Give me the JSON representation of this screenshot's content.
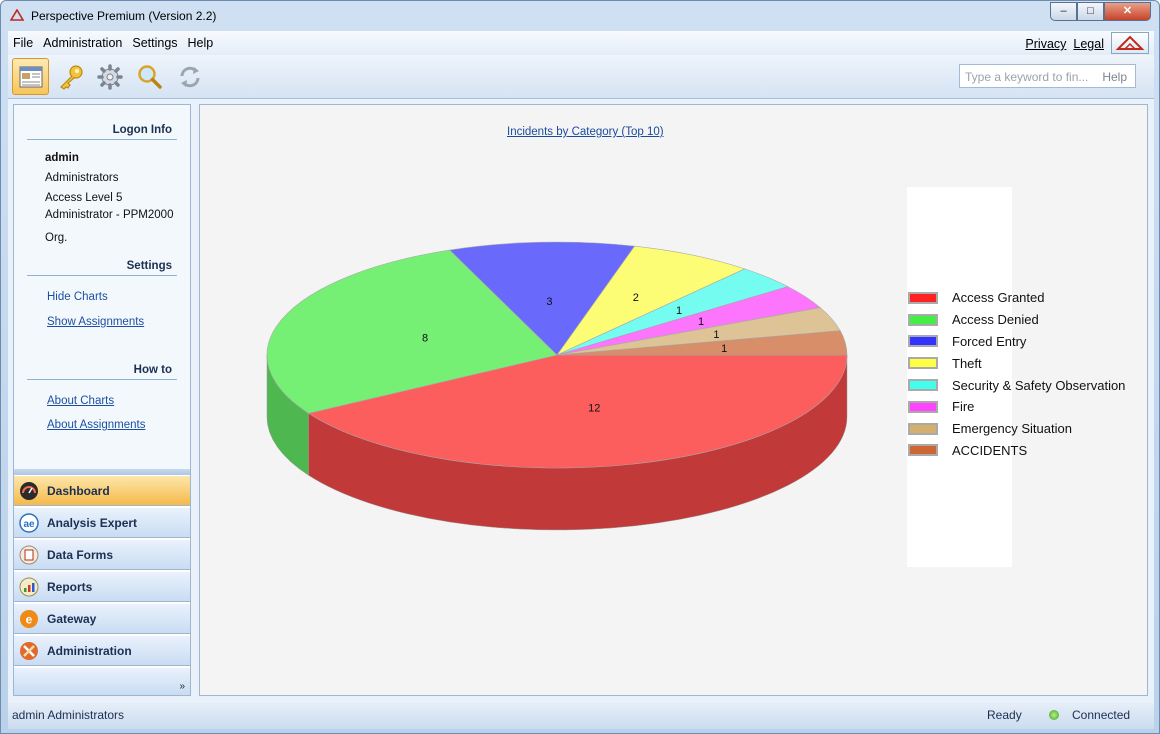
{
  "window": {
    "title": "Perspective Premium (Version 2.2)",
    "min": "‒",
    "max": "□",
    "close": "✕"
  },
  "menu": {
    "items": [
      "File",
      "Administration",
      "Settings",
      "Help"
    ],
    "privacy": "Privacy",
    "legal": "Legal"
  },
  "toolbar": {
    "icons": [
      "dashboard-icon",
      "key-icon",
      "gear-icon",
      "search-icon",
      "refresh-icon"
    ],
    "search_placeholder": "Type a keyword to fin...",
    "help": "Help"
  },
  "logon": {
    "heading": "Logon Info",
    "user": "admin",
    "group": "Administrators",
    "access_level": "Access Level 5",
    "admin_name": "Administrator - PPM2000",
    "org": "Org."
  },
  "settings": {
    "heading": "Settings",
    "hide_charts": "Hide Charts",
    "show_assignments": "Show Assignments"
  },
  "howto": {
    "heading": "How to",
    "about_charts": "About Charts",
    "about_assignments": "About Assignments"
  },
  "nav": {
    "items": [
      {
        "label": "Dashboard",
        "icon": "dashboard-icon",
        "color": "#2b2b2b"
      },
      {
        "label": "Analysis Expert",
        "icon": "analysis-expert-icon",
        "color": "#2a6fc2"
      },
      {
        "label": "Data Forms",
        "icon": "data-forms-icon",
        "color": "#e0d6c4"
      },
      {
        "label": "Reports",
        "icon": "reports-icon",
        "color": "#e7d9a5"
      },
      {
        "label": "Gateway",
        "icon": "gateway-icon",
        "color": "#ef8a16"
      },
      {
        "label": "Administration",
        "icon": "administration-icon",
        "color": "#e06a2a"
      }
    ],
    "more": "»"
  },
  "chart_data": {
    "type": "pie",
    "title": "Incidents by Category (Top 10)",
    "categories": [
      "Access Granted",
      "Access Denied",
      "Forced Entry",
      "Theft",
      "Security & Safety Observation",
      "Fire",
      "Emergency Situation",
      "ACCIDENTS"
    ],
    "values": [
      12,
      8,
      3,
      2,
      1,
      1,
      1,
      1
    ],
    "colors": [
      "#ff2222",
      "#44ee44",
      "#3333ff",
      "#ffff44",
      "#44ffee",
      "#ff44ff",
      "#d4b070",
      "#cc6633"
    ],
    "legend_position": "right",
    "style": "3d"
  },
  "status": {
    "user": "admin  Administrators",
    "ready": "Ready",
    "connection": "Connected"
  }
}
